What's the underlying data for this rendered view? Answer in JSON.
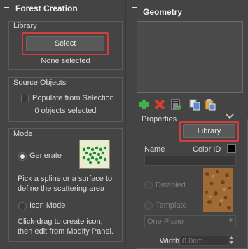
{
  "colors": {
    "panel_bg": "#444444",
    "highlight_red": "#d03e3e",
    "viewport_bg": "#4b4b4b",
    "color_id_swatch": "#000000"
  },
  "forest": {
    "title": "Forest Creation",
    "library": {
      "label": "Library",
      "select_button": "Select",
      "status": "None selected"
    },
    "source_objects": {
      "label": "Source Objects",
      "populate_checkbox": "Populate from Selection",
      "populate_checked": false,
      "status": "0 objects selected"
    },
    "mode": {
      "label": "Mode",
      "generate_label": "Generate",
      "generate_selected": true,
      "generate_description_1": "Pick a spline or a surface to",
      "generate_description_2": "define the scattering area",
      "icon_mode_label": "Icon Mode",
      "icon_mode_selected": false,
      "icon_mode_description_1": "Click-drag to create icon,",
      "icon_mode_description_2": "then edit from Modify Panel."
    }
  },
  "geometry": {
    "title": "Geometry",
    "toolbar_icons": [
      "add-icon",
      "delete-icon",
      "list-icon",
      "copy-icon",
      "paste-icon"
    ],
    "properties": {
      "label": "Properties",
      "library_button": "Library",
      "name_label": "Name",
      "color_id_label": "Color ID",
      "name_value": "",
      "disabled_label": "Disabled",
      "template_label": "Template",
      "plane_select": "One Plane",
      "width_label": "Width",
      "width_value": "0.0cm"
    }
  }
}
